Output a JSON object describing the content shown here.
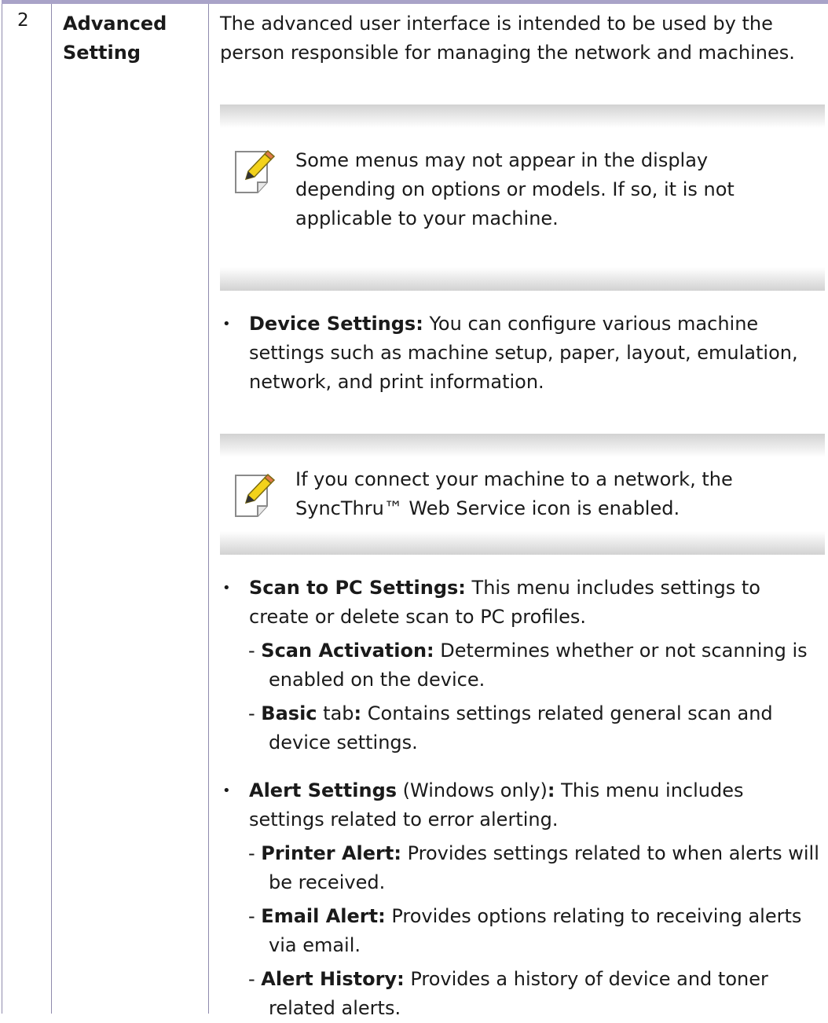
{
  "row": {
    "number": "2",
    "title_line1": "Advanced",
    "title_line2": "Setting"
  },
  "intro": "The advanced user interface is intended to be used by the person responsible for managing the network and machines.",
  "note1": {
    "icon": "note-pencil-icon",
    "text": "Some menus may not appear in the display depending on options or models. If so, it is not applicable to your machine."
  },
  "device_settings": {
    "label": "Device Settings:",
    "text": " You can configure various machine settings such as machine setup, paper, layout, emulation, network, and print information."
  },
  "note2": {
    "icon": "note-pencil-icon",
    "text": "If you connect your machine to a network, the SyncThru™ Web Service icon is enabled."
  },
  "scan_settings": {
    "label": "Scan to PC Settings:",
    "text": " This menu includes settings to create or delete scan to PC profiles.",
    "subs": [
      {
        "dash": "- ",
        "label": "Scan Activation:",
        "mid": "",
        "colon": "",
        "text": " Determines whether or not scanning is enabled on the device."
      },
      {
        "dash": "- ",
        "label": "Basic",
        "mid": " tab",
        "colon": ":",
        "text": " Contains settings related general scan and device settings."
      }
    ]
  },
  "alert_settings": {
    "label": "Alert Settings",
    "mid": " (Windows only)",
    "colon": ":",
    "text": " This menu includes settings related to error alerting.",
    "subs": [
      {
        "dash": "- ",
        "label": "Printer Alert:",
        "text": " Provides settings related to when alerts will be received."
      },
      {
        "dash": "- ",
        "label": "Email Alert:",
        "text": " Provides options relating to receiving alerts via email."
      },
      {
        "dash": "- ",
        "label": "Alert History:",
        "text": " Provides a history of device and toner related alerts."
      }
    ]
  }
}
